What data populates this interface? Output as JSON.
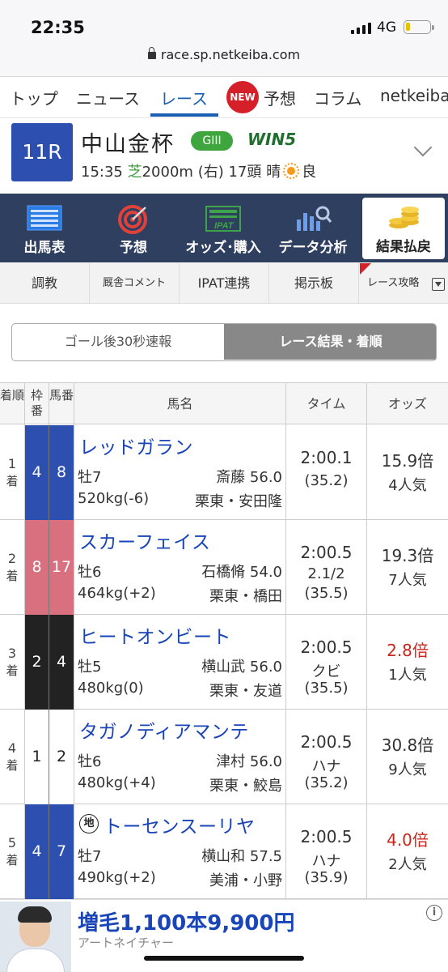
{
  "status_bar": {
    "time": "22:35",
    "network": "4G"
  },
  "browser": {
    "url": "race.sp.netkeiba.com"
  },
  "top_nav": {
    "items": [
      "トップ",
      "ニュース",
      "レース",
      "予想",
      "コラム",
      "netkeiba"
    ],
    "active": "レース",
    "new_badge": "NEW"
  },
  "race": {
    "number": "11R",
    "name": "中山金杯",
    "grade": "GIII",
    "win5": "WIN5",
    "time": "15:35",
    "surface": "芝",
    "distance": "2000m",
    "direction": "(右)",
    "runners": "17頭",
    "weather": "晴",
    "track_condition": "良"
  },
  "main_menu": [
    {
      "label": "出馬表",
      "icon": "list-icon"
    },
    {
      "label": "予想",
      "icon": "target-icon"
    },
    {
      "label": "オッズ･購入",
      "icon": "ipat-icon"
    },
    {
      "label": "データ分析",
      "icon": "chart-search-icon"
    },
    {
      "label": "結果払戻",
      "icon": "coins-icon"
    }
  ],
  "sub_tabs": [
    "調教",
    "厩舎コメント",
    "IPAT連携",
    "掲示板",
    "レース攻略"
  ],
  "toggle": {
    "left": "ゴール後30秒速報",
    "right": "レース結果・着順"
  },
  "table": {
    "headers": {
      "rank": "着順",
      "waku": "枠番",
      "uma": "馬番",
      "name": "馬名",
      "time": "タイム",
      "odds": "オッズ"
    },
    "rows": [
      {
        "rank": "1",
        "rank_suffix": "着",
        "waku": "4",
        "uma": "8",
        "horse": "レッドガラン",
        "chihou": false,
        "sex_age": "牡7",
        "jockey_weight": "斎藤 56.0",
        "body_weight": "520kg(-6)",
        "trainer": "栗東・安田隆",
        "time": "2:00.1",
        "margin": "",
        "last3f": "(35.2)",
        "odds": "15.9倍",
        "popularity": "4人気",
        "favored": false
      },
      {
        "rank": "2",
        "rank_suffix": "着",
        "waku": "8",
        "uma": "17",
        "horse": "スカーフェイス",
        "chihou": false,
        "sex_age": "牡6",
        "jockey_weight": "石橋脩 54.0",
        "body_weight": "464kg(+2)",
        "trainer": "栗東・橋田",
        "time": "2:00.5",
        "margin": "2.1/2",
        "last3f": "(35.5)",
        "odds": "19.3倍",
        "popularity": "7人気",
        "favored": false
      },
      {
        "rank": "3",
        "rank_suffix": "着",
        "waku": "2",
        "uma": "4",
        "horse": "ヒートオンビート",
        "chihou": false,
        "sex_age": "牡5",
        "jockey_weight": "横山武 56.0",
        "body_weight": "480kg(0)",
        "trainer": "栗東・友道",
        "time": "2:00.5",
        "margin": "クビ",
        "last3f": "(35.5)",
        "odds": "2.8倍",
        "popularity": "1人気",
        "favored": true
      },
      {
        "rank": "4",
        "rank_suffix": "着",
        "waku": "1",
        "uma": "2",
        "horse": "タガノディアマンテ",
        "chihou": false,
        "sex_age": "牡6",
        "jockey_weight": "津村 56.0",
        "body_weight": "480kg(+4)",
        "trainer": "栗東・鮫島",
        "time": "2:00.5",
        "margin": "ハナ",
        "last3f": "(35.2)",
        "odds": "30.8倍",
        "popularity": "9人気",
        "favored": false
      },
      {
        "rank": "5",
        "rank_suffix": "着",
        "waku": "4",
        "uma": "7",
        "horse": "トーセンスーリヤ",
        "chihou": true,
        "chihou_mark": "地",
        "sex_age": "牡7",
        "jockey_weight": "横山和 57.5",
        "body_weight": "490kg(+2)",
        "trainer": "美浦・小野",
        "time": "2:00.5",
        "margin": "ハナ",
        "last3f": "(35.9)",
        "odds": "4.0倍",
        "popularity": "2人気",
        "favored": true
      }
    ]
  },
  "waku_colors": {
    "1": {
      "bg": "#ffffff",
      "fg": "#222222"
    },
    "2": {
      "bg": "#222222",
      "fg": "#ffffff"
    },
    "4": {
      "bg": "#2c4fb0",
      "fg": "#ffffff"
    },
    "8": {
      "bg": "#d9707f",
      "fg": "#ffffff"
    }
  },
  "ad": {
    "title": "増毛1,100本9,900円",
    "sponsor": "アートネイチャー",
    "info_icon": "i"
  }
}
